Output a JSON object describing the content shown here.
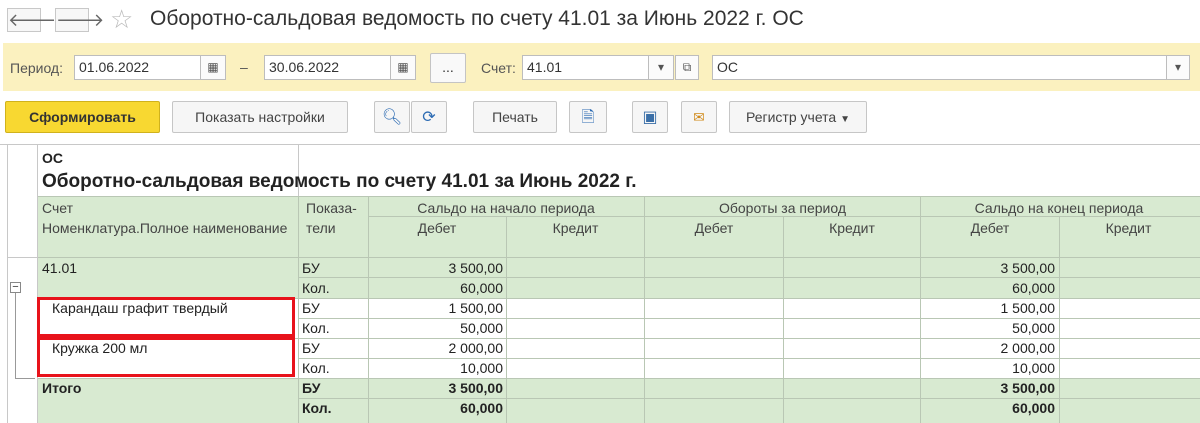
{
  "window": {
    "title": "Оборотно-сальдовая ведомость по счету 41.01 за Июнь 2022 г. ОС"
  },
  "filters": {
    "period_label": "Период:",
    "date_from": "01.06.2022",
    "dash": "–",
    "date_to": "30.06.2022",
    "dots": "...",
    "account_label": "Счет:",
    "account": "41.01",
    "org": "ОС"
  },
  "toolbar": {
    "generate": "Сформировать",
    "show_settings": "Показать настройки",
    "print": "Печать",
    "register": "Регистр учета"
  },
  "report": {
    "org": "ОС",
    "title": "Оборотно-сальдовая ведомость по счету 41.01 за Июнь 2022 г.",
    "headers": {
      "account": "Счет",
      "nomenclature": "Номенклатура.Полное наименование",
      "indicators": "Показа-тели",
      "opening": "Сальдо на начало периода",
      "turnover": "Обороты за период",
      "closing": "Сальдо на конец периода",
      "debit": "Дебет",
      "credit": "Кредит"
    },
    "rows": [
      {
        "name": "41.01",
        "ind": "БУ",
        "open_debit": "3 500,00",
        "close_debit": "3 500,00"
      },
      {
        "name": "",
        "ind": "Кол.",
        "open_debit": "60,000",
        "close_debit": "60,000"
      },
      {
        "name": "Карандаш графит твердый",
        "ind": "БУ",
        "open_debit": "1 500,00",
        "close_debit": "1 500,00"
      },
      {
        "name": "",
        "ind": "Кол.",
        "open_debit": "50,000",
        "close_debit": "50,000"
      },
      {
        "name": "Кружка 200 мл",
        "ind": "БУ",
        "open_debit": "2 000,00",
        "close_debit": "2 000,00"
      },
      {
        "name": "",
        "ind": "Кол.",
        "open_debit": "10,000",
        "close_debit": "10,000"
      },
      {
        "name": "Итого",
        "ind": "БУ",
        "open_debit": "3 500,00",
        "close_debit": "3 500,00"
      },
      {
        "name": "",
        "ind": "Кол.",
        "open_debit": "60,000",
        "close_debit": "60,000"
      }
    ],
    "collapse_glyph": "−"
  },
  "colors": {
    "accent_yellow": "#f8d831",
    "panel": "#fbf1bf",
    "table_green": "#d8ead1",
    "highlight_red": "#e8131b"
  }
}
